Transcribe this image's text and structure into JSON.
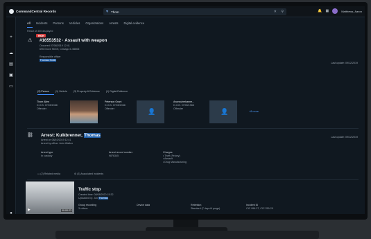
{
  "app": {
    "name": "CommandCentral Records"
  },
  "search": {
    "term": "Thom"
  },
  "user": {
    "name": "Matthews, Aaron"
  },
  "tabs": [
    "All",
    "Incidents",
    "Persons",
    "Vehicles",
    "Organizations",
    "Arrests",
    "Digital evidence"
  ],
  "results_count": "Result of 300 displayed",
  "incident": {
    "badge": "HIGH",
    "title": "#16553532 · Assault with weapon",
    "occurred": "Occurred 07/08/2019 12:41",
    "address": "695 Grove Street, Chicago IL 66606",
    "officer_label": "Responsible officer",
    "officer": "Thomas Smith",
    "updated": "Last update: 09/12/2019",
    "subtabs": [
      "(2) Person",
      "(1) Vehicle",
      "(3) Property & Evidence",
      "(1) Digital Evidence"
    ],
    "persons": [
      {
        "name": "Thom Allen",
        "dob": "D.O.B. 07/05/1988",
        "role": "Offender"
      },
      {
        "name": "Peterson Grant",
        "dob": "D.O.B. 07/05/1988",
        "role": "Offender"
      },
      {
        "name": "Anonsuhrekanne...",
        "dob": "D.O.B. 07/05/1988",
        "role": "Offender"
      }
    ],
    "more": "+8 more"
  },
  "arrest": {
    "title_prefix": "Arrest: Kulkbrenner, ",
    "title_hl": "Thomas",
    "meta1": "Arrest on 08/10/2019 12:41",
    "meta2": "Arrest by officer John Walker",
    "updated": "Last update: 09/12/2019",
    "type_label": "Arrest type",
    "type_value": "In custody",
    "record_label": "Arrest record number",
    "record_value": "9876345",
    "charges_label": "Charges",
    "charges": [
      "• Theft (Felony)",
      "• Assault",
      "• Drug Manufacturing"
    ],
    "related_media": "(2) Related media",
    "associated": "(3) Associated incidents"
  },
  "traffic": {
    "title": "Traffic stop",
    "meta1": "Created time: 08/08/2020 15:32",
    "meta2_prefix": "Uploaded by: Jon ",
    "meta2_hl": "Thomas",
    "group_label": "Group recording",
    "group_value": "3 videos",
    "device_label": "Device data",
    "retention_label": "Retention",
    "retention_value": "Standard (7 days til purge)",
    "incident_label": "Incident ID",
    "incident_value": "CIC 996-27, CIC 259-29",
    "duration": "00:00:23"
  }
}
